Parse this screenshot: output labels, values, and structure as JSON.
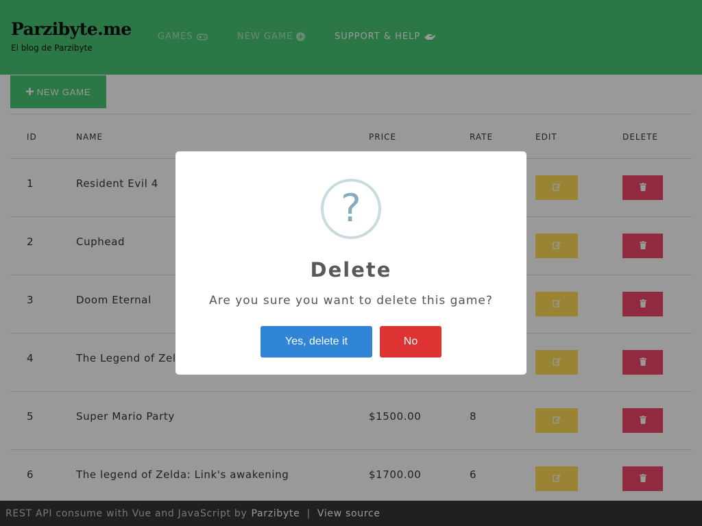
{
  "brand": {
    "title": "Parzibyte.me",
    "subtitle": "El blog de Parzibyte"
  },
  "nav": {
    "items": [
      {
        "label": "GAMES",
        "icon": "gamepad-icon"
      },
      {
        "label": "NEW GAME",
        "icon": "plus-circle-icon"
      },
      {
        "label": "SUPPORT & HELP",
        "icon": "hands-helping-icon"
      }
    ]
  },
  "toolbar": {
    "new_game_label": "NEW GAME",
    "new_game_icon": "plus-icon"
  },
  "table": {
    "headers": [
      "ID",
      "NAME",
      "PRICE",
      "RATE",
      "EDIT",
      "DELETE"
    ],
    "rows": [
      {
        "id": "1",
        "name": "Resident Evil 4",
        "price": "",
        "rate": ""
      },
      {
        "id": "2",
        "name": "Cuphead",
        "price": "",
        "rate": ""
      },
      {
        "id": "3",
        "name": "Doom Eternal",
        "price": "",
        "rate": ""
      },
      {
        "id": "4",
        "name": "The Legend of Zel",
        "price": "",
        "rate": ""
      },
      {
        "id": "5",
        "name": "Super Mario Party",
        "price": "$1500.00",
        "rate": "8"
      },
      {
        "id": "6",
        "name": "The legend of Zelda: Link's awakening",
        "price": "$1700.00",
        "rate": "6"
      }
    ]
  },
  "footer": {
    "text": "REST API consume with Vue and JavaScript by",
    "author_link": "Parzibyte",
    "separator": "|",
    "source_link": "View source"
  },
  "modal": {
    "icon": "question-icon",
    "icon_char": "?",
    "title": "Delete",
    "message": "Are you sure you want to delete this game?",
    "confirm_label": "Yes, delete it",
    "cancel_label": "No"
  },
  "colors": {
    "navbar": "#48c774",
    "edit_button": "#ffdd57",
    "delete_button": "#f14668",
    "confirm_button": "#3085d6",
    "cancel_button": "#dd3333",
    "footer": "#363636"
  }
}
